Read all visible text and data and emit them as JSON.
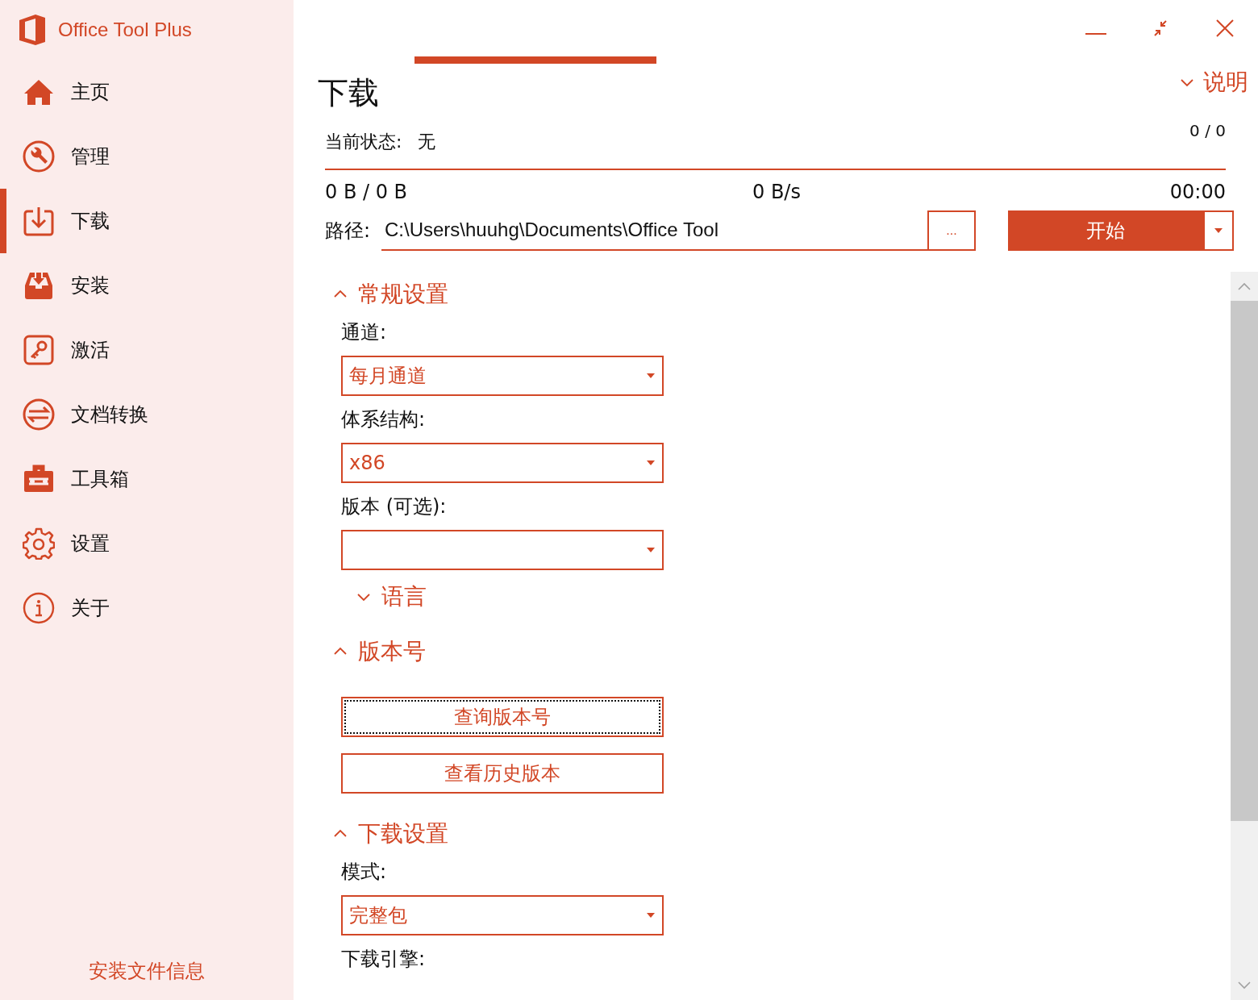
{
  "app": {
    "title": "Office Tool Plus"
  },
  "sidebar": {
    "items": [
      {
        "label": "主页",
        "selected": false
      },
      {
        "label": "管理",
        "selected": false
      },
      {
        "label": "下载",
        "selected": true
      },
      {
        "label": "安装",
        "selected": false
      },
      {
        "label": "激活",
        "selected": false
      },
      {
        "label": "文档转换",
        "selected": false
      },
      {
        "label": "工具箱",
        "selected": false
      },
      {
        "label": "设置",
        "selected": false
      },
      {
        "label": "关于",
        "selected": false
      }
    ],
    "footer_link": "安装文件信息"
  },
  "page": {
    "title": "下载",
    "help_toggle": {
      "label": "说明",
      "expanded": false
    },
    "status_label": "当前状态:",
    "status_value": "无",
    "count": "0 / 0",
    "size": "0 B / 0 B",
    "speed": "0 B/s",
    "time": "00:00",
    "path_label": "路径:",
    "path_value": "C:\\Users\\huuhg\\Documents\\Office Tool",
    "browse_button": "...",
    "start_button": "开始"
  },
  "sections": [
    {
      "title": "常规设置",
      "expanded": true,
      "items": [
        {
          "kind": "select",
          "label": "通道:",
          "value": "每月通道"
        },
        {
          "kind": "select",
          "label": "体系结构:",
          "value": "x86"
        },
        {
          "kind": "select",
          "label": "版本 (可选):",
          "value": ""
        },
        {
          "kind": "subsection",
          "label": "语言",
          "expanded": false
        }
      ]
    },
    {
      "title": "版本号",
      "expanded": true,
      "items": [
        {
          "kind": "button",
          "label": "查询版本号",
          "focused": true
        },
        {
          "kind": "button",
          "label": "查看历史版本",
          "focused": false
        }
      ]
    },
    {
      "title": "下载设置",
      "expanded": true,
      "items": [
        {
          "kind": "select",
          "label": "模式:",
          "value": "完整包"
        },
        {
          "kind": "label",
          "label": "下载引擎:"
        }
      ]
    }
  ]
}
